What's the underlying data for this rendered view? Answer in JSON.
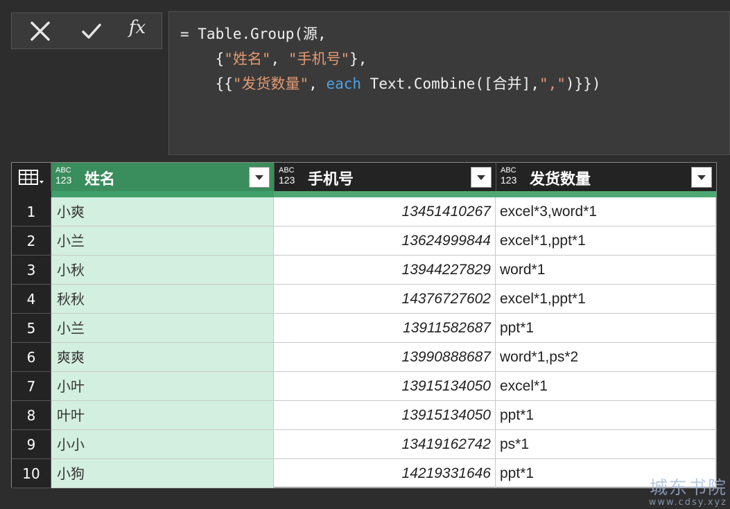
{
  "formula_bar": {
    "fx_label": "fx",
    "lines": [
      [
        {
          "t": "= Table.Group(源,",
          "c": "plain"
        }
      ],
      [
        {
          "t": "    {",
          "c": "plain"
        },
        {
          "t": "\"姓名\"",
          "c": "str"
        },
        {
          "t": ", ",
          "c": "plain"
        },
        {
          "t": "\"手机号\"",
          "c": "str"
        },
        {
          "t": "},",
          "c": "plain"
        }
      ],
      [
        {
          "t": "    {{",
          "c": "plain"
        },
        {
          "t": "\"发货数量\"",
          "c": "str"
        },
        {
          "t": ", ",
          "c": "plain"
        },
        {
          "t": "each",
          "c": "kw"
        },
        {
          "t": " Text.Combine([合并],",
          "c": "plain"
        },
        {
          "t": "\",\"",
          "c": "str"
        },
        {
          "t": ")}})",
          "c": "plain"
        }
      ]
    ]
  },
  "grid": {
    "columns": [
      {
        "type_top": "ABC",
        "type_bottom": "123",
        "title": "姓名",
        "selected": true
      },
      {
        "type_top": "ABC",
        "type_bottom": "123",
        "title": "手机号",
        "selected": false
      },
      {
        "type_top": "ABC",
        "type_bottom": "123",
        "title": "发货数量",
        "selected": false
      }
    ],
    "rows": [
      {
        "idx": "1",
        "name": "小爽",
        "phone": "13451410267",
        "qty": "excel*3,word*1"
      },
      {
        "idx": "2",
        "name": "小兰",
        "phone": "13624999844",
        "qty": "excel*1,ppt*1"
      },
      {
        "idx": "3",
        "name": "小秋",
        "phone": "13944227829",
        "qty": "word*1"
      },
      {
        "idx": "4",
        "name": "秋秋",
        "phone": "14376727602",
        "qty": "excel*1,ppt*1"
      },
      {
        "idx": "5",
        "name": "小兰",
        "phone": "13911582687",
        "qty": "ppt*1"
      },
      {
        "idx": "6",
        "name": "爽爽",
        "phone": "13990888687",
        "qty": "word*1,ps*2"
      },
      {
        "idx": "7",
        "name": "小叶",
        "phone": "13915134050",
        "qty": "excel*1"
      },
      {
        "idx": "8",
        "name": "叶叶",
        "phone": "13915134050",
        "qty": "ppt*1"
      },
      {
        "idx": "9",
        "name": "小小",
        "phone": "13419162742",
        "qty": "ps*1"
      },
      {
        "idx": "10",
        "name": "小狗",
        "phone": "14219331646",
        "qty": "ppt*1"
      }
    ]
  },
  "watermark": {
    "line1": "城东书院",
    "line2": "www.cdsy.xyz"
  },
  "colors": {
    "accent": "#3a8d5c",
    "selected_cell": "#d3efdf",
    "string": "#e29a73",
    "keyword": "#4ea3e6"
  }
}
